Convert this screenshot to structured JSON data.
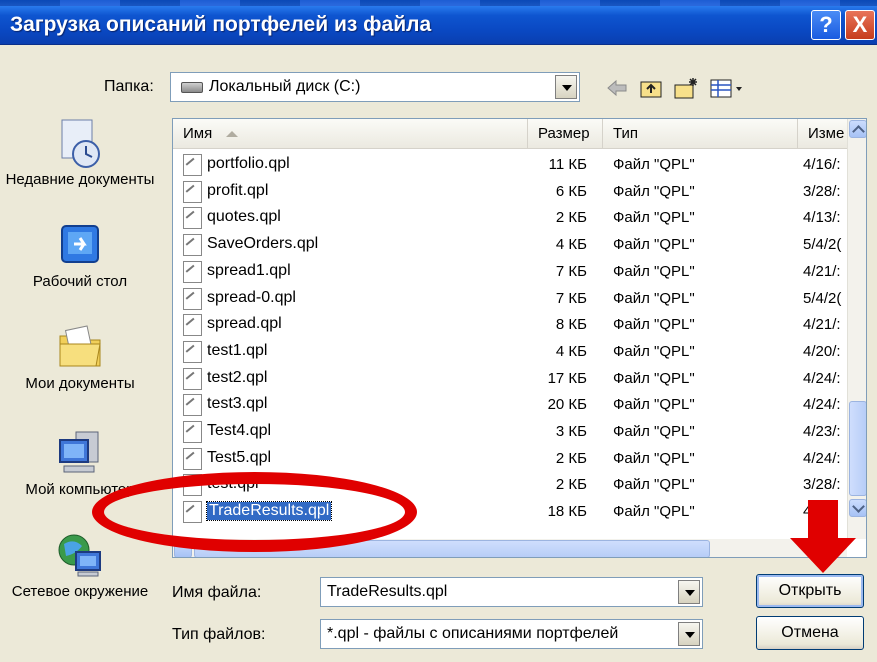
{
  "window": {
    "title": "Загрузка описаний портфелей из файла",
    "help_glyph": "?",
    "close_glyph": "X"
  },
  "folder_bar": {
    "label": "Папка:",
    "current_folder": "Локальный диск (C:)",
    "icons": [
      "back-arrow-icon",
      "up-folder-icon",
      "new-folder-icon",
      "view-menu-icon"
    ]
  },
  "places": [
    {
      "label": "Недавние документы",
      "icon": "recent-documents-icon"
    },
    {
      "label": "Рабочий стол",
      "icon": "desktop-icon"
    },
    {
      "label": "Мои документы",
      "icon": "my-documents-icon"
    },
    {
      "label": "Мой компьютер",
      "icon": "my-computer-icon"
    },
    {
      "label": "Сетевое окружение",
      "icon": "network-icon"
    }
  ],
  "columns": {
    "name": "Имя",
    "size": "Размер",
    "type": "Тип",
    "date": "Изме"
  },
  "files": [
    {
      "name": "portfolio.qpl",
      "size": "11 КБ",
      "type": "Файл \"QPL\"",
      "date": "4/16/:"
    },
    {
      "name": "profit.qpl",
      "size": "6 КБ",
      "type": "Файл \"QPL\"",
      "date": "3/28/:"
    },
    {
      "name": "quotes.qpl",
      "size": "2 КБ",
      "type": "Файл \"QPL\"",
      "date": "4/13/:"
    },
    {
      "name": "SaveOrders.qpl",
      "size": "4 КБ",
      "type": "Файл \"QPL\"",
      "date": "5/4/2("
    },
    {
      "name": "spread1.qpl",
      "size": "7 КБ",
      "type": "Файл \"QPL\"",
      "date": "4/21/:"
    },
    {
      "name": "spread-0.qpl",
      "size": "7 КБ",
      "type": "Файл \"QPL\"",
      "date": "5/4/2("
    },
    {
      "name": "spread.qpl",
      "size": "8 КБ",
      "type": "Файл \"QPL\"",
      "date": "4/21/:"
    },
    {
      "name": "test1.qpl",
      "size": "4 КБ",
      "type": "Файл \"QPL\"",
      "date": "4/20/:"
    },
    {
      "name": "test2.qpl",
      "size": "17 КБ",
      "type": "Файл \"QPL\"",
      "date": "4/24/:"
    },
    {
      "name": "test3.qpl",
      "size": "20 КБ",
      "type": "Файл \"QPL\"",
      "date": "4/24/:"
    },
    {
      "name": "Test4.qpl",
      "size": "3 КБ",
      "type": "Файл \"QPL\"",
      "date": "4/23/:"
    },
    {
      "name": "Test5.qpl",
      "size": "2 КБ",
      "type": "Файл \"QPL\"",
      "date": "4/24/:"
    },
    {
      "name": "test.qpl",
      "size": "2 КБ",
      "type": "Файл \"QPL\"",
      "date": "3/28/:"
    },
    {
      "name": "TradeResults.qpl",
      "size": "18 КБ",
      "type": "Файл \"QPL\"",
      "date": "4/"
    }
  ],
  "selected_file": "TradeResults.qpl",
  "filename_field": {
    "label": "Имя файла:",
    "value": "TradeResults.qpl"
  },
  "filetype_field": {
    "label": "Тип файлов:",
    "value": "*.qpl - файлы с описаниями портфелей"
  },
  "buttons": {
    "open": "Открыть",
    "cancel": "Отмена"
  },
  "annotation_color": "#e00000"
}
